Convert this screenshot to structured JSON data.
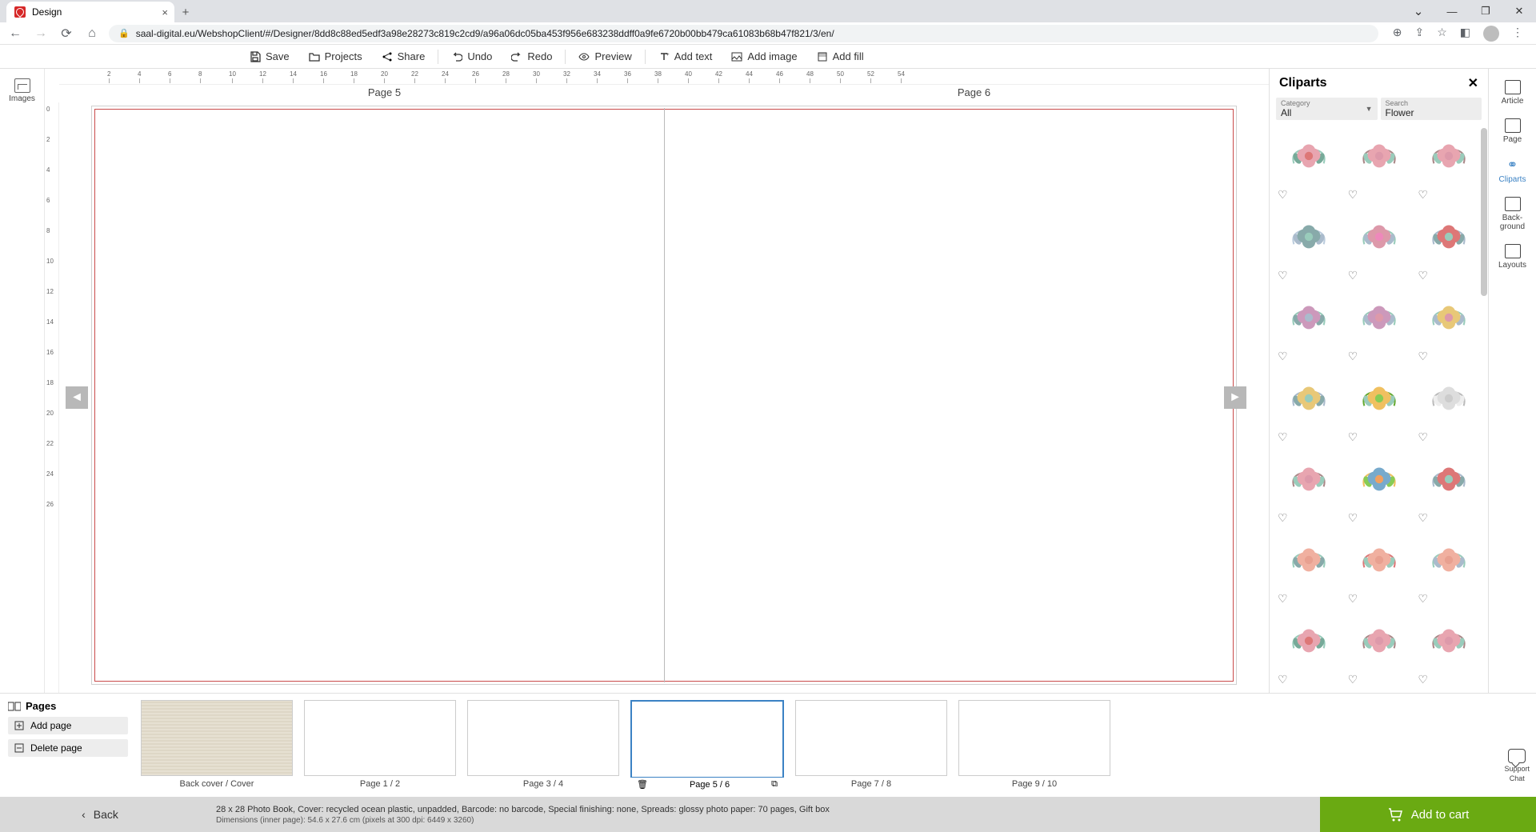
{
  "browser": {
    "tab_title": "Design",
    "url": "saal-digital.eu/WebshopClient/#/Designer/8dd8c88ed5edf3a98e28273c819c2cd9/a96a06dc05ba453f956e683238ddff0a9fe6720b00bb479ca61083b68b47f821/3/en/"
  },
  "toolbar": {
    "save": "Save",
    "projects": "Projects",
    "share": "Share",
    "undo": "Undo",
    "redo": "Redo",
    "preview": "Preview",
    "add_text": "Add text",
    "add_image": "Add image",
    "add_fill": "Add fill"
  },
  "left_rail": {
    "images": "Images"
  },
  "canvas": {
    "page_left": "Page 5",
    "page_right": "Page 6",
    "h_ticks": [
      "2",
      "4",
      "6",
      "8",
      "10",
      "12",
      "14",
      "16",
      "18",
      "20",
      "22",
      "24",
      "26",
      "28",
      "30",
      "32",
      "34",
      "36",
      "38",
      "40",
      "42",
      "44",
      "46",
      "48",
      "50",
      "52",
      "54"
    ],
    "v_ticks": [
      "0",
      "2",
      "4",
      "6",
      "8",
      "10",
      "12",
      "14",
      "16",
      "18",
      "20",
      "22",
      "24",
      "26"
    ]
  },
  "cliparts": {
    "title": "Cliparts",
    "category_label": "Category",
    "category_value": "All",
    "search_label": "Search",
    "search_value": "Flower"
  },
  "right_rail": {
    "article": "Article",
    "page": "Page",
    "cliparts": "Cliparts",
    "background": "Back-\nground",
    "layouts": "Layouts"
  },
  "pages": {
    "title": "Pages",
    "add": "Add page",
    "delete": "Delete page",
    "thumbs": [
      {
        "label": "Back cover / Cover",
        "cover": true
      },
      {
        "label": "Page 1 / 2"
      },
      {
        "label": "Page 3 / 4"
      },
      {
        "label": "Page 5 / 6",
        "active": true
      },
      {
        "label": "Page 7 / 8"
      },
      {
        "label": "Page 9 / 10"
      }
    ]
  },
  "bottom": {
    "back": "Back",
    "product": "28 x 28 Photo Book, Cover: recycled ocean plastic, unpadded, Barcode: no barcode, Special finishing: none, Spreads: glossy photo paper: 70 pages, Gift box",
    "dimensions": "Dimensions (inner page): 54.6 x 27.6 cm (pixels at 300 dpi: 6449 x 3260)",
    "add_to_cart": "Add to cart"
  },
  "support": {
    "line1": "Support",
    "line2": "Chat"
  }
}
